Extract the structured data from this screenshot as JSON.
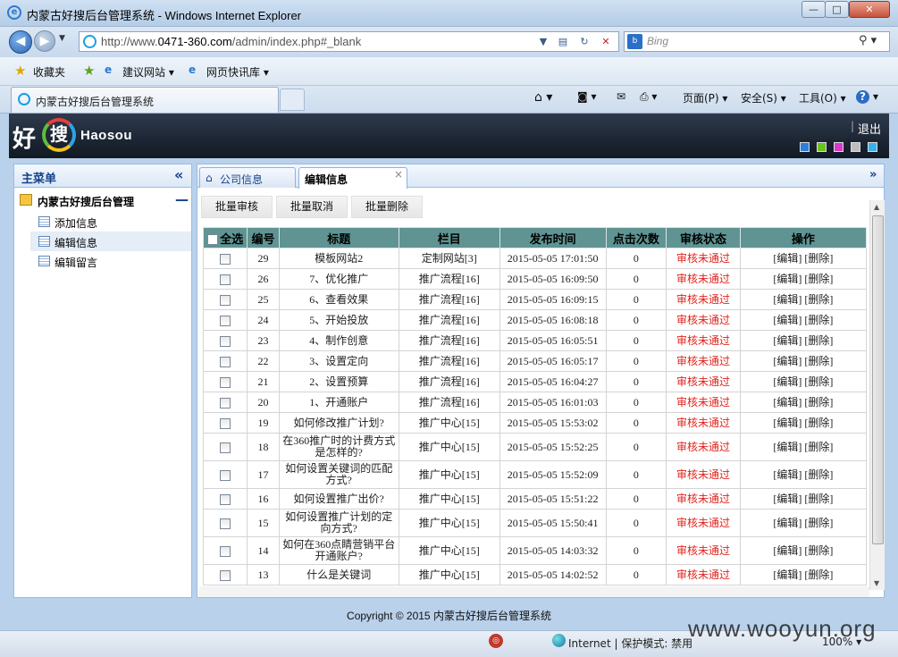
{
  "window": {
    "title": "内蒙古好搜后台管理系统 - Windows Internet Explorer",
    "min": "—",
    "max": "□",
    "close": "✕"
  },
  "address": {
    "url_prefix": "http://www.",
    "url_domain": "0471-360.com",
    "url_suffix": "/admin/index.php#_blank",
    "search_placeholder": "Bing"
  },
  "favorites": {
    "favorites_label": "收藏夹",
    "suggested_label": "建议网站 ▾",
    "slices_label": "网页快讯库 ▾"
  },
  "ie_tab": {
    "label": "内蒙古好搜后台管理系统"
  },
  "commands": {
    "page": "页面(P) ▾",
    "safety": "安全(S) ▾",
    "tools": "工具(O) ▾",
    "help": "? ▾"
  },
  "header": {
    "logo_cn_1": "好",
    "logo_cn_2": "搜",
    "logo_en": "Haosou",
    "logout": "退出",
    "skin_colors": [
      "#2f7fd8",
      "#6cc21e",
      "#d43bc8",
      "#bdbdbd",
      "#3bb0e8"
    ]
  },
  "sidebar": {
    "title": "主菜单",
    "collapse": "«",
    "group": "内蒙古好搜后台管理",
    "group_toggle": "—",
    "items": [
      {
        "label": "添加信息"
      },
      {
        "label": "编辑信息"
      },
      {
        "label": "编辑留言"
      }
    ]
  },
  "main_tabs": [
    {
      "label": "公司信息"
    },
    {
      "label": "编辑信息",
      "close": "×"
    }
  ],
  "toolbar": {
    "approve": "批量审核",
    "cancel": "批量取消",
    "delete": "批量删除"
  },
  "table": {
    "headers": [
      "全选",
      "编号",
      "标题",
      "栏目",
      "发布时间",
      "点击次数",
      "审核状态",
      "操作"
    ],
    "rows": [
      {
        "id": "29",
        "title": "模板网站2",
        "category": "定制网站[3]",
        "time": "2015-05-05 17:01:50",
        "clicks": "0",
        "status": "审核未通过",
        "ops": "[编辑] [删除]"
      },
      {
        "id": "26",
        "title": "7、优化推广",
        "category": "推广流程[16]",
        "time": "2015-05-05 16:09:50",
        "clicks": "0",
        "status": "审核未通过",
        "ops": "[编辑] [删除]"
      },
      {
        "id": "25",
        "title": "6、查看效果",
        "category": "推广流程[16]",
        "time": "2015-05-05 16:09:15",
        "clicks": "0",
        "status": "审核未通过",
        "ops": "[编辑] [删除]"
      },
      {
        "id": "24",
        "title": "5、开始投放",
        "category": "推广流程[16]",
        "time": "2015-05-05 16:08:18",
        "clicks": "0",
        "status": "审核未通过",
        "ops": "[编辑] [删除]"
      },
      {
        "id": "23",
        "title": "4、制作创意",
        "category": "推广流程[16]",
        "time": "2015-05-05 16:05:51",
        "clicks": "0",
        "status": "审核未通过",
        "ops": "[编辑] [删除]"
      },
      {
        "id": "22",
        "title": "3、设置定向",
        "category": "推广流程[16]",
        "time": "2015-05-05 16:05:17",
        "clicks": "0",
        "status": "审核未通过",
        "ops": "[编辑] [删除]"
      },
      {
        "id": "21",
        "title": "2、设置预算",
        "category": "推广流程[16]",
        "time": "2015-05-05 16:04:27",
        "clicks": "0",
        "status": "审核未通过",
        "ops": "[编辑] [删除]"
      },
      {
        "id": "20",
        "title": "1、开通账户",
        "category": "推广流程[16]",
        "time": "2015-05-05 16:01:03",
        "clicks": "0",
        "status": "审核未通过",
        "ops": "[编辑] [删除]"
      },
      {
        "id": "19",
        "title": "如何修改推广计划?",
        "category": "推广中心[15]",
        "time": "2015-05-05 15:53:02",
        "clicks": "0",
        "status": "审核未通过",
        "ops": "[编辑] [删除]"
      },
      {
        "id": "18",
        "title": "在360推广时的计费方式是怎样的?",
        "category": "推广中心[15]",
        "time": "2015-05-05 15:52:25",
        "clicks": "0",
        "status": "审核未通过",
        "ops": "[编辑] [删除]",
        "tall": true
      },
      {
        "id": "17",
        "title": "如何设置关键词的匹配方式?",
        "category": "推广中心[15]",
        "time": "2015-05-05 15:52:09",
        "clicks": "0",
        "status": "审核未通过",
        "ops": "[编辑] [删除]",
        "tall": true
      },
      {
        "id": "16",
        "title": "如何设置推广出价?",
        "category": "推广中心[15]",
        "time": "2015-05-05 15:51:22",
        "clicks": "0",
        "status": "审核未通过",
        "ops": "[编辑] [删除]"
      },
      {
        "id": "15",
        "title": "如何设置推广计划的定向方式?",
        "category": "推广中心[15]",
        "time": "2015-05-05 15:50:41",
        "clicks": "0",
        "status": "审核未通过",
        "ops": "[编辑] [删除]",
        "tall": true
      },
      {
        "id": "14",
        "title": "如何在360点睛营销平台开通账户?",
        "category": "推广中心[15]",
        "time": "2015-05-05 14:03:32",
        "clicks": "0",
        "status": "审核未通过",
        "ops": "[编辑] [删除]",
        "tall": true
      },
      {
        "id": "13",
        "title": "什么是关键词",
        "category": "推广中心[15]",
        "time": "2015-05-05 14:02:52",
        "clicks": "0",
        "status": "审核未通过",
        "ops": "[编辑] [删除]"
      }
    ]
  },
  "footer": {
    "copyright": "Copyright © 2015 内蒙古好搜后台管理系统"
  },
  "statusbar": {
    "zone": "Internet | 保护模式: 禁用",
    "zoom": "100% ▾"
  },
  "watermark": "www.wooyun.org"
}
